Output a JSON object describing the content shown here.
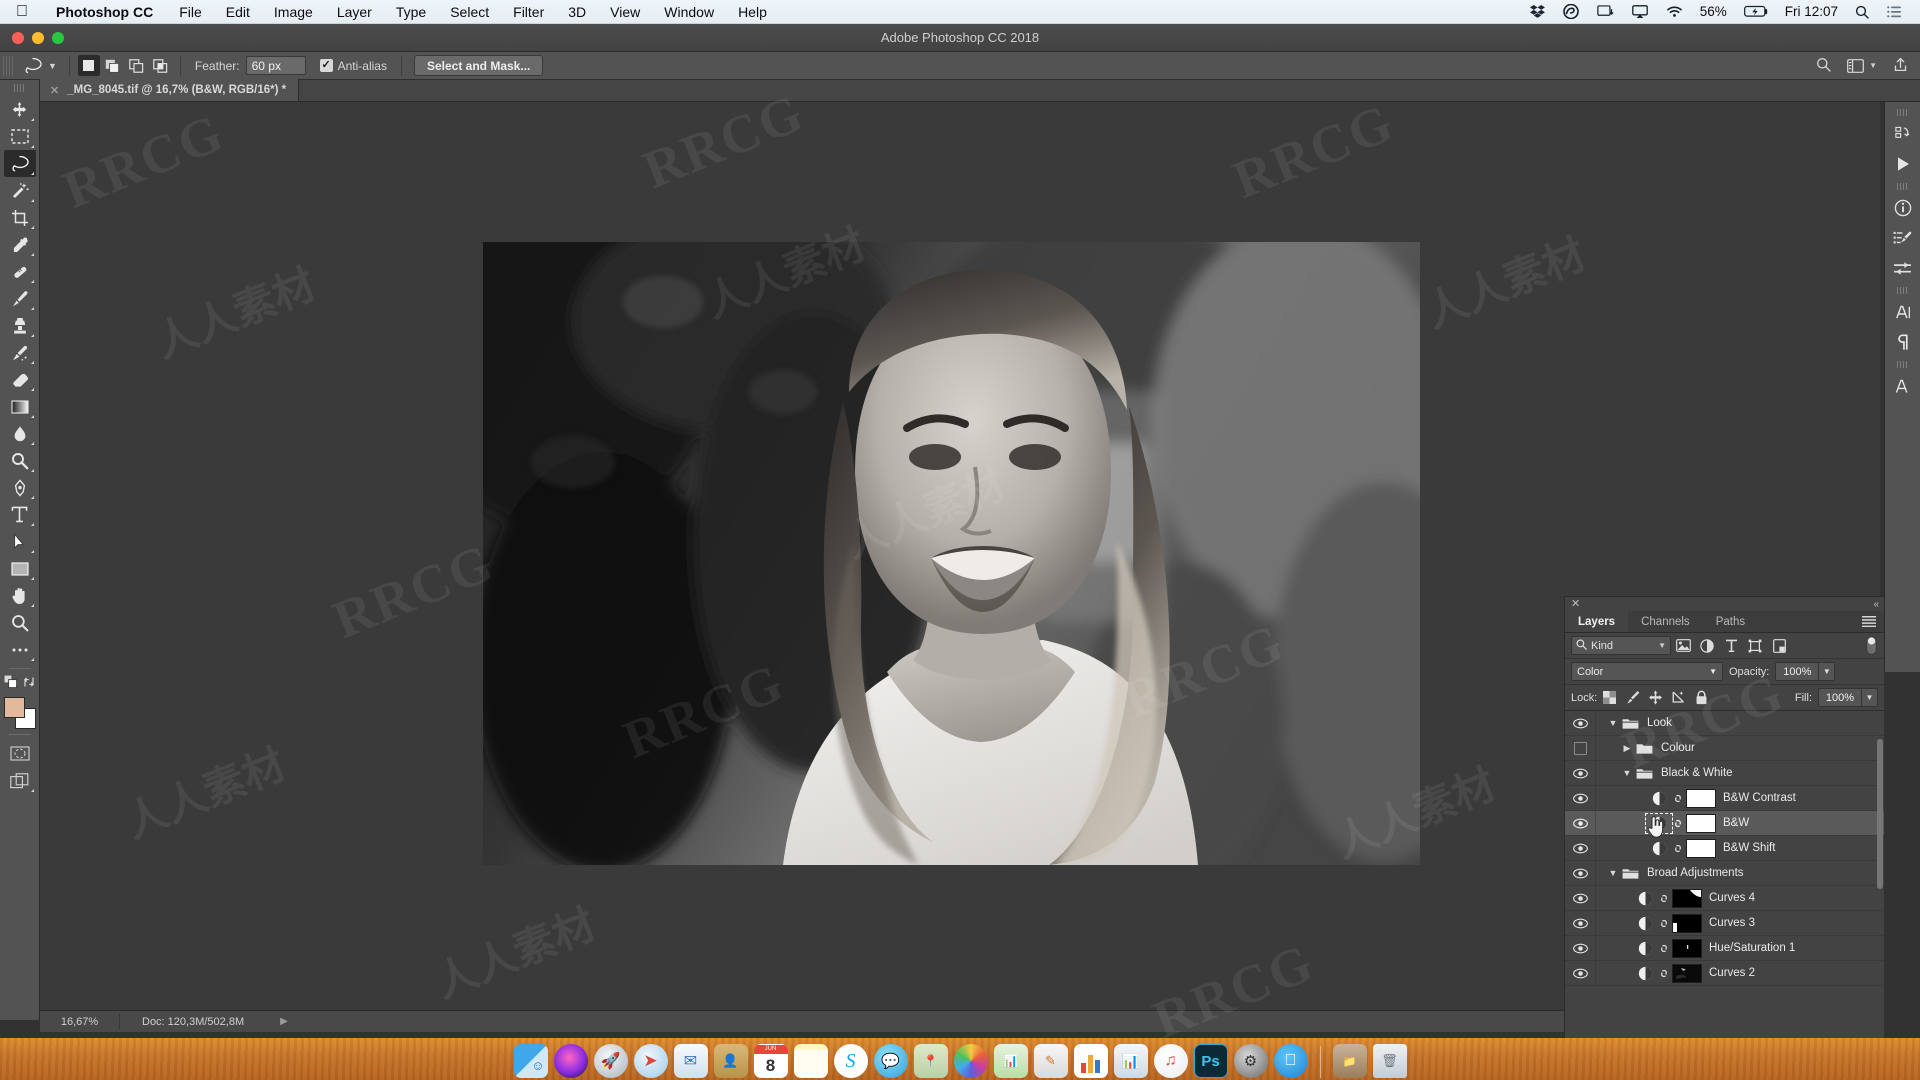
{
  "menubar": {
    "apple_icon": "apple-icon",
    "app_name": "Photoshop CC",
    "items": [
      "File",
      "Edit",
      "Image",
      "Layer",
      "Type",
      "Select",
      "Filter",
      "3D",
      "View",
      "Window",
      "Help"
    ],
    "status_icons": [
      "dropbox-icon",
      "creative-cloud-icon",
      "display-icon",
      "airplay-icon",
      "wifi-icon"
    ],
    "battery_percent": "56%",
    "battery_icon": "battery-charging-icon",
    "clock": "Fri 12:07",
    "search_icon": "spotlight-search-icon",
    "control_center_icon": "notification-center-icon"
  },
  "window": {
    "title": "Adobe Photoshop CC 2018",
    "traffic_lights": [
      "close",
      "minimize",
      "zoom"
    ]
  },
  "options_bar": {
    "tool_icon": "lasso-tool-icon",
    "tool_preset_chevron": "chevron-down-icon",
    "selection_modes": [
      "new-selection-icon",
      "add-to-selection-icon",
      "subtract-from-selection-icon",
      "intersect-selection-icon"
    ],
    "active_selection_mode": 0,
    "feather_label": "Feather:",
    "feather_value": "60 px",
    "antialias_label": "Anti-alias",
    "antialias_checked": true,
    "select_and_mask_label": "Select and Mask...",
    "right_icons": [
      "search-icon",
      "workspace-icon",
      "chevron-down-icon",
      "share-icon"
    ]
  },
  "document_tab": {
    "close_icon": "close-icon",
    "title": "_MG_8045.tif @ 16,7% (B&W, RGB/16*) *"
  },
  "toolbar": {
    "tools": [
      {
        "name": "move-tool",
        "glyph": "move"
      },
      {
        "name": "marquee-tool",
        "glyph": "marquee"
      },
      {
        "name": "lasso-tool",
        "glyph": "lasso",
        "active": true
      },
      {
        "name": "magic-wand-tool",
        "glyph": "wand"
      },
      {
        "name": "crop-tool",
        "glyph": "crop"
      },
      {
        "name": "eyedropper-tool",
        "glyph": "eyedropper"
      },
      {
        "name": "spot-healing-brush-tool",
        "glyph": "healing"
      },
      {
        "name": "brush-tool",
        "glyph": "brush"
      },
      {
        "name": "clone-stamp-tool",
        "glyph": "stamp"
      },
      {
        "name": "history-brush-tool",
        "glyph": "historybrush"
      },
      {
        "name": "eraser-tool",
        "glyph": "eraser"
      },
      {
        "name": "gradient-tool",
        "glyph": "gradient"
      },
      {
        "name": "blur-tool",
        "glyph": "blur"
      },
      {
        "name": "dodge-tool",
        "glyph": "dodge"
      },
      {
        "name": "pen-tool",
        "glyph": "pen"
      },
      {
        "name": "type-tool",
        "glyph": "type"
      },
      {
        "name": "path-selection-tool",
        "glyph": "pathselect"
      },
      {
        "name": "rectangle-tool",
        "glyph": "rect"
      },
      {
        "name": "hand-tool",
        "glyph": "hand"
      },
      {
        "name": "zoom-tool",
        "glyph": "zoom"
      },
      {
        "name": "edit-toolbar-tool",
        "glyph": "dots"
      }
    ],
    "foreground_color": "#e3b99c",
    "background_color": "#ffffff",
    "swap_icon": "swap-colors-icon",
    "default_colors_icon": "default-colors-icon",
    "quick_mask_icon": "quick-mask-icon",
    "screen_mode_icon": "screen-mode-icon"
  },
  "right_rail": {
    "icons": [
      "history-panel-icon",
      "actions-panel-icon",
      "info-panel-icon",
      "brush-settings-panel-icon",
      "adjustments-panel-icon",
      "character-panel-icon",
      "paragraph-panel-icon",
      "character-styles-panel-icon"
    ]
  },
  "layers_panel": {
    "close_icon": "close-icon",
    "collapse_icon": "collapse-panel-icon",
    "menu_icon": "panel-menu-icon",
    "tabs": [
      {
        "label": "Layers",
        "active": true
      },
      {
        "label": "Channels",
        "active": false
      },
      {
        "label": "Paths",
        "active": false
      }
    ],
    "filter": {
      "search_icon": "search-icon",
      "kind_label": "Kind",
      "chevron": "chevron-down-icon",
      "type_icons": [
        "pixel-layer-filter-icon",
        "adjustment-layer-filter-icon",
        "type-layer-filter-icon",
        "shape-layer-filter-icon",
        "smart-object-filter-icon"
      ],
      "toggle_icon": "filter-toggle-icon"
    },
    "blend_mode": "Color",
    "opacity_label": "Opacity:",
    "opacity_value": "100%",
    "lock_label": "Lock:",
    "lock_icons": [
      "lock-transparent-pixels-icon",
      "lock-image-pixels-icon",
      "lock-position-icon",
      "lock-artboard-nesting-icon",
      "lock-all-icon"
    ],
    "fill_label": "Fill:",
    "fill_value": "100%",
    "rows": [
      {
        "name": "Look",
        "type": "group",
        "visible": true,
        "expanded": true,
        "indent": 0,
        "selected": false
      },
      {
        "name": "Colour",
        "type": "group",
        "visible": false,
        "expanded": false,
        "indent": 1,
        "selected": false
      },
      {
        "name": "Black & White",
        "type": "group",
        "visible": true,
        "expanded": true,
        "indent": 1,
        "selected": false
      },
      {
        "name": "B&W Contrast",
        "type": "adjustment",
        "visible": true,
        "indent": 2,
        "selected": false,
        "mask": "white"
      },
      {
        "name": "B&W",
        "type": "adjustment",
        "visible": true,
        "indent": 2,
        "selected": true,
        "mask": "white"
      },
      {
        "name": "B&W Shift",
        "type": "adjustment",
        "visible": true,
        "indent": 2,
        "selected": false,
        "mask": "white"
      },
      {
        "name": "Broad Adjustments",
        "type": "group",
        "visible": true,
        "expanded": true,
        "indent": 0,
        "selected": false
      },
      {
        "name": "Curves 4",
        "type": "adjustment",
        "visible": true,
        "indent": 1,
        "selected": false,
        "mask": "black-corner"
      },
      {
        "name": "Curves 3",
        "type": "adjustment",
        "visible": true,
        "indent": 1,
        "selected": false,
        "mask": "black-left"
      },
      {
        "name": "Hue/Saturation 1",
        "type": "adjustment",
        "visible": true,
        "indent": 1,
        "selected": false,
        "mask": "black-speck"
      },
      {
        "name": "Curves 2",
        "type": "adjustment",
        "visible": true,
        "indent": 1,
        "selected": false,
        "mask": "black-wisp"
      }
    ],
    "bottom_icons": [
      "link-layers-icon",
      "add-layer-style-icon",
      "add-layer-mask-icon",
      "new-adjustment-layer-icon",
      "new-group-icon",
      "new-layer-icon",
      "delete-layer-icon"
    ]
  },
  "status_bar": {
    "zoom": "16,67%",
    "doc_label": "Doc: 120,3M/502,8M",
    "expand_icon": "chevron-right-icon"
  },
  "dock": {
    "items": [
      {
        "name": "finder",
        "running": true
      },
      {
        "name": "siri",
        "running": false
      },
      {
        "name": "launchpad",
        "running": false
      },
      {
        "name": "safari",
        "running": false
      },
      {
        "name": "mail",
        "running": false
      },
      {
        "name": "contacts",
        "running": false
      },
      {
        "name": "calendar",
        "running": false,
        "day": "8",
        "month": "JUN"
      },
      {
        "name": "notes",
        "running": false
      },
      {
        "name": "skype",
        "running": false
      },
      {
        "name": "messages",
        "running": false
      },
      {
        "name": "maps",
        "running": false
      },
      {
        "name": "photos",
        "running": false
      },
      {
        "name": "numbers",
        "running": false
      },
      {
        "name": "pages",
        "running": false
      },
      {
        "name": "chart-app",
        "running": false
      },
      {
        "name": "keynote",
        "running": false
      },
      {
        "name": "itunes",
        "running": false
      },
      {
        "name": "photoshop",
        "running": true
      },
      {
        "name": "system-preferences",
        "running": false
      },
      {
        "name": "app-store",
        "running": false
      },
      {
        "name": "downloads-stack",
        "running": false
      },
      {
        "name": "trash",
        "running": false
      }
    ]
  },
  "watermarks": {
    "latin": "RRCG",
    "cjk": "人人素材"
  }
}
